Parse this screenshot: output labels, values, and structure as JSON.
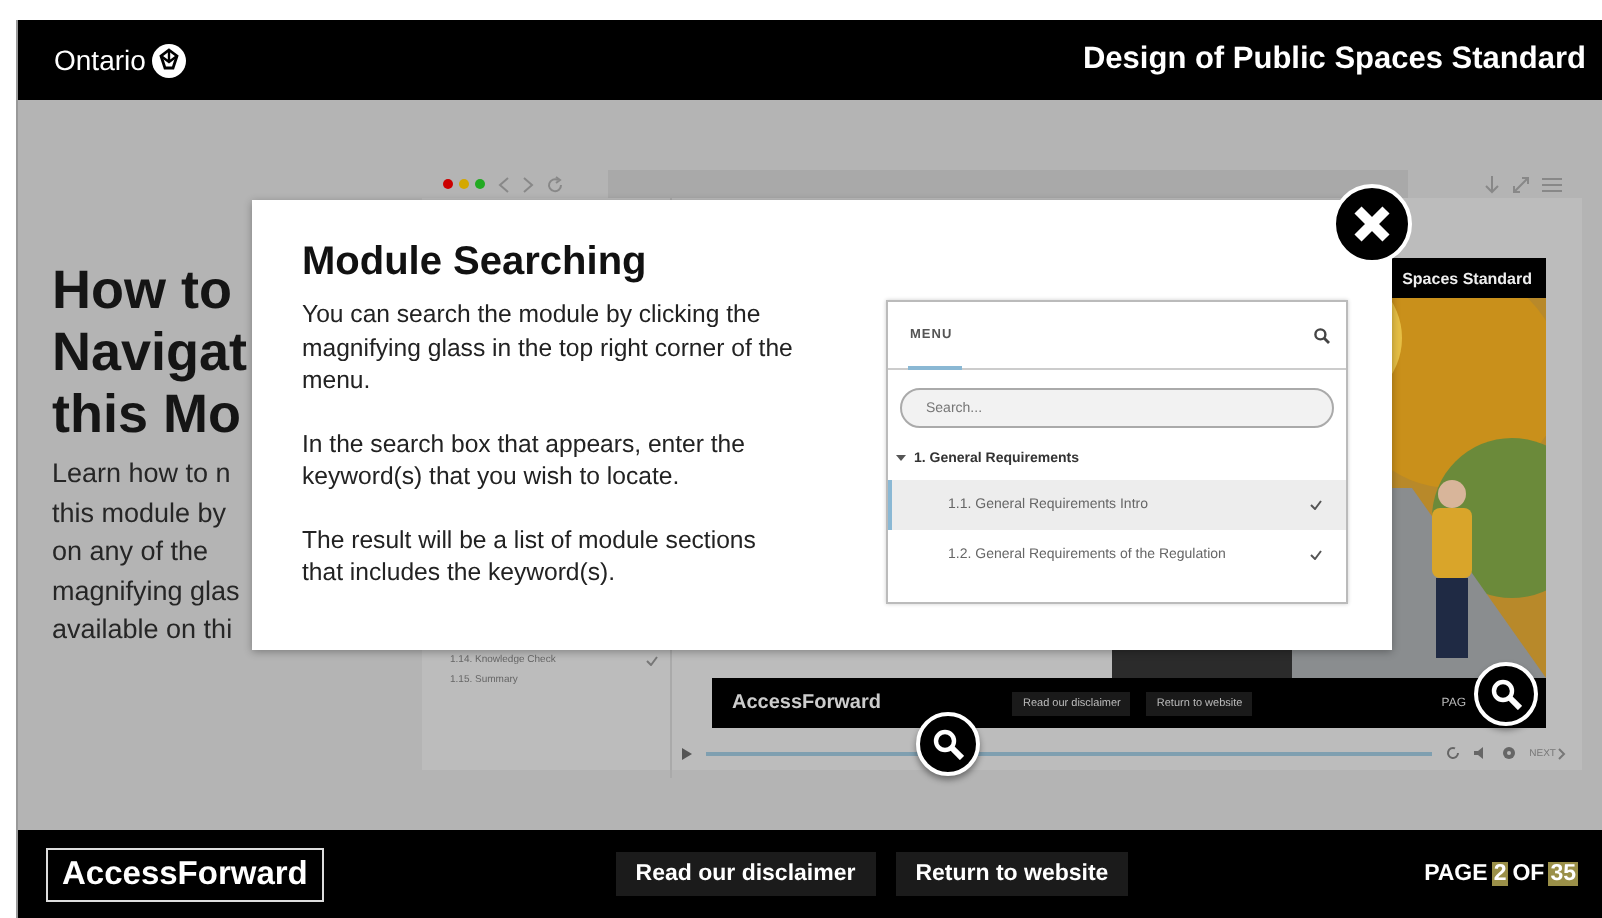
{
  "header": {
    "logo_text": "Ontario",
    "title": "Design of Public Spaces Standard"
  },
  "page": {
    "heading_lines": [
      "How to",
      "Navigat",
      "this Mo"
    ],
    "intro_lines": [
      "Learn how to n",
      "this module by",
      "on any of the",
      "magnifying glas",
      "available on thi"
    ]
  },
  "preview": {
    "nav_items": [
      {
        "label": "1.14. Knowledge Check",
        "checked": true
      },
      {
        "label": "1.15. Summary",
        "checked": false
      }
    ],
    "image_caption": "Spaces Standard",
    "footer": {
      "brand": "AccessForward",
      "buttons": [
        "Read our disclaimer",
        "Return to website"
      ],
      "page_text": "PAG"
    },
    "progress": {
      "level": 1
    },
    "next_label": "NEXT"
  },
  "modal": {
    "title": "Module Searching",
    "paragraphs": [
      "You can search the module by clicking the magnifying glass in the top right corner of the menu.",
      "In the search box that appears, enter the keyword(s) that you wish to locate.",
      "The result will be a list of module sections that includes the keyword(s)."
    ],
    "menu": {
      "title": "MENU",
      "search_placeholder": "Search...",
      "tree": [
        {
          "label": "1. General Requirements",
          "expanded": true,
          "children": [
            {
              "label": "1.1. General Requirements Intro",
              "selected": true,
              "checked": true
            },
            {
              "label": "1.2. General Requirements of the Regulation",
              "selected": false,
              "checked": true
            }
          ]
        }
      ]
    }
  },
  "footer": {
    "brand": "AccessForward",
    "buttons": [
      "Read our disclaimer",
      "Return to website"
    ],
    "page_label": "PAGE",
    "current_page": "2",
    "of_label": "OF",
    "total_pages": "35"
  }
}
